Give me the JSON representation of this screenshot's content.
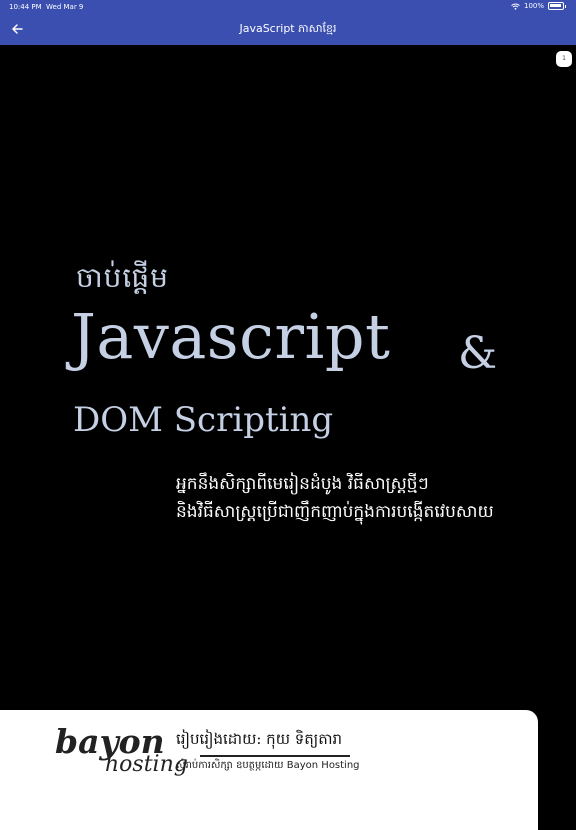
{
  "status_bar": {
    "time": "10:44 PM",
    "date": "Wed Mar 9",
    "battery": "100%"
  },
  "nav": {
    "title": "JavaScript ភាសាខ្មែរ"
  },
  "page_badge": "1",
  "cover": {
    "kh_start": "ចាប់ផ្តើម",
    "title": "Javascript",
    "amp": "&",
    "subtitle": "DOM Scripting",
    "kh_line1": "អ្នកនឹងសិក្សាពីមេរៀនដំបូង វិធីសាស្ត្រថ្មីៗ",
    "kh_line2": "និងវិធីសាស្ត្រប្រើជាញឹកញាប់ក្នុងការបង្កើតវេបសាយ"
  },
  "footer": {
    "logo_line1": "bayon",
    "logo_line2": "hosting",
    "author": "រៀបរៀងដោយ: កុយ ទិត្យតារា",
    "cut_text": "សំរាប់ការសិក្សា ឧបត្ថម្ភដោយ Bayon Hosting"
  },
  "colors": {
    "nav_bg": "#3a4fb0",
    "title_text": "#c5d0e4",
    "background": "#000000"
  }
}
